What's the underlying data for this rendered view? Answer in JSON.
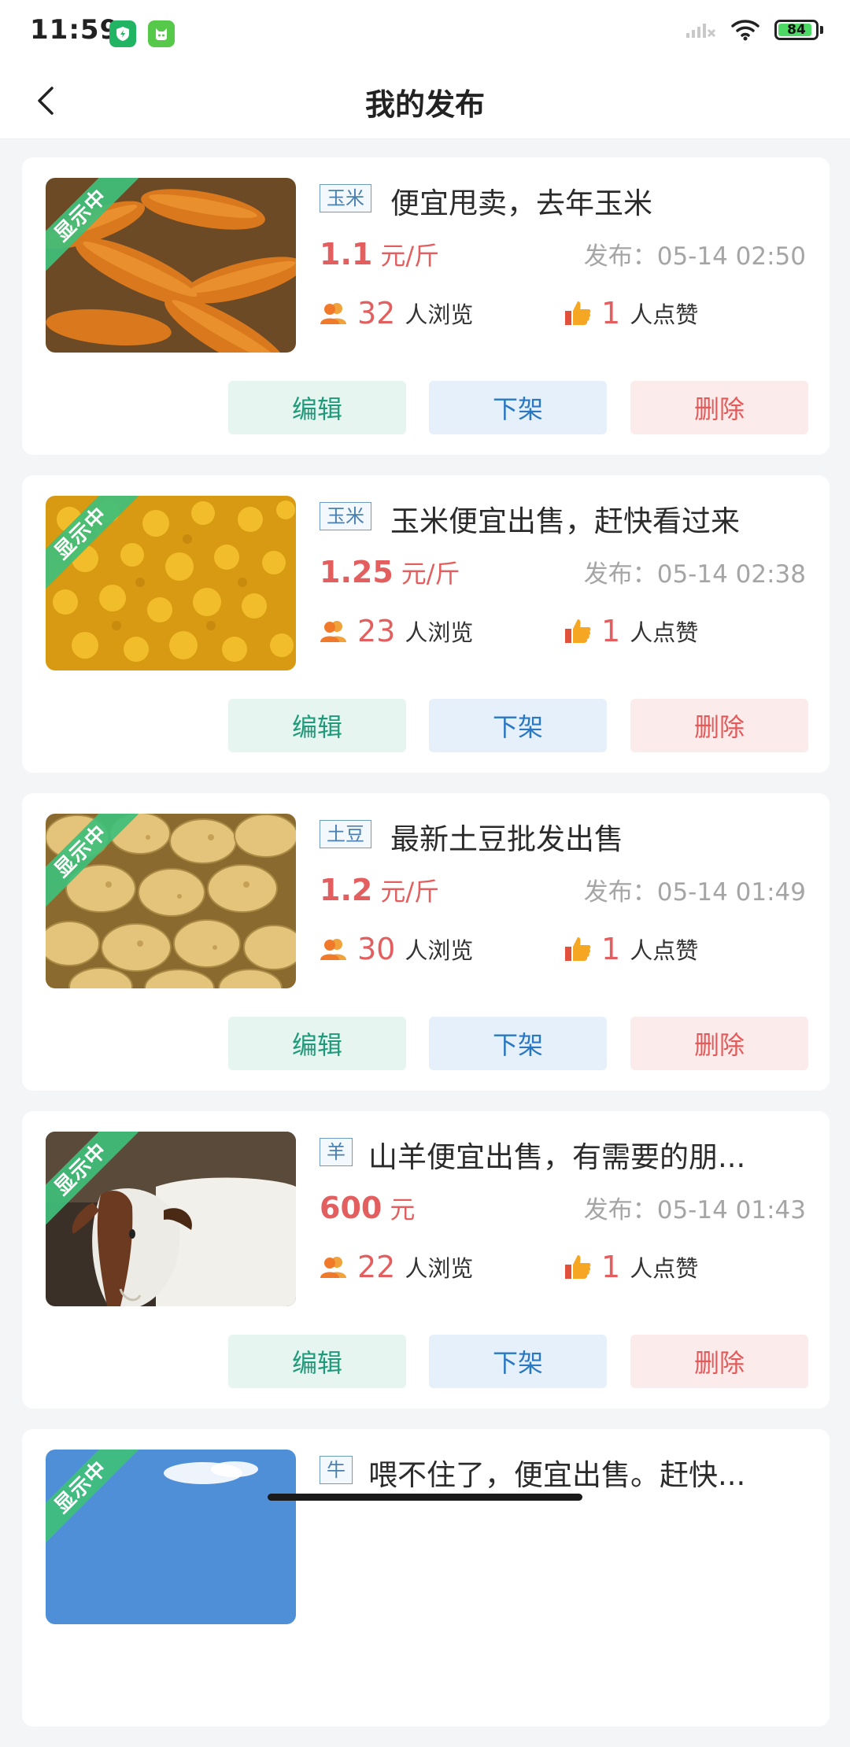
{
  "status_bar": {
    "time": "11:59",
    "battery": "84"
  },
  "header": {
    "title": "我的发布"
  },
  "labels": {
    "status_ribbon": "显示中",
    "publish_prefix": "发布：",
    "views_label": "人浏览",
    "likes_label": "人点赞",
    "edit": "编辑",
    "take_down": "下架",
    "delete": "删除"
  },
  "listings": [
    {
      "tag": "玉米",
      "title": "便宜甩卖，去年玉米",
      "price": "1.1",
      "unit": "元/斤",
      "publish_time": "05-14 02:50",
      "views": "32",
      "likes": "1",
      "image": "corn-ears"
    },
    {
      "tag": "玉米",
      "title": "玉米便宜出售，赶快看过来",
      "price": "1.25",
      "unit": "元/斤",
      "publish_time": "05-14 02:38",
      "views": "23",
      "likes": "1",
      "image": "corn-pile"
    },
    {
      "tag": "土豆",
      "title": "最新土豆批发出售",
      "price": "1.2",
      "unit": "元/斤",
      "publish_time": "05-14 01:49",
      "views": "30",
      "likes": "1",
      "image": "potatoes"
    },
    {
      "tag": "羊",
      "title": "山羊便宜出售，有需要的朋...",
      "price": "600",
      "unit": "元",
      "publish_time": "05-14 01:43",
      "views": "22",
      "likes": "1",
      "image": "goat"
    },
    {
      "tag": "牛",
      "title": "喂不住了，便宜出售。赶快...",
      "price": "",
      "unit": "",
      "publish_time": "",
      "views": "",
      "likes": "",
      "image": "sky"
    }
  ]
}
